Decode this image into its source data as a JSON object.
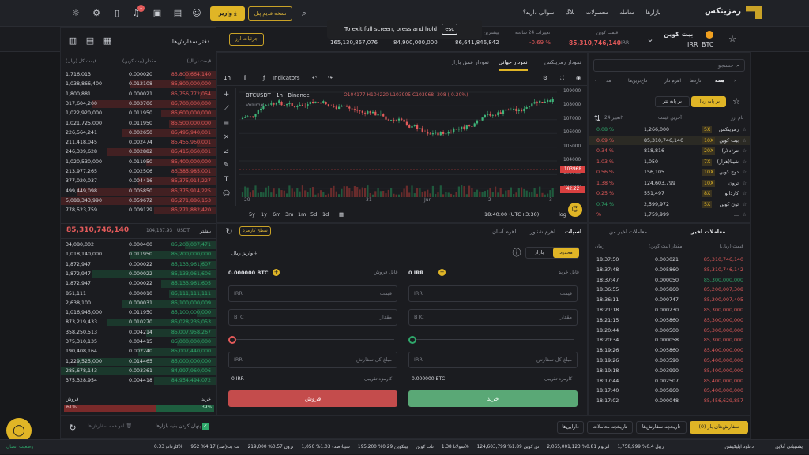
{
  "header": {
    "logo": "رمزینکس",
    "nav": [
      "بازارها",
      "معامله",
      "محصولات",
      "بلاگ",
      "سوالی دارید؟"
    ],
    "old_version": "نسخه قدیم پنل",
    "deposit": "واریز",
    "notif_count": "1"
  },
  "fullscreen_toast": {
    "text": "To exit full screen, press and hold",
    "key": "esc"
  },
  "ticker": {
    "name": "بیت کوین",
    "symbol": "BTC",
    "quote": "IRR",
    "price_label": "قیمت کوین",
    "price": "85,310,746,140",
    "price_unit": "IRR",
    "change_label": "تغییرات 24 ساعته",
    "change": "-0.69 %",
    "high_label": "بیشترین",
    "high": "86,641,846,842",
    "low": "84,900,000,000",
    "volume": "165,130,867,076",
    "details_btn": "جزئیات ارز"
  },
  "orderbook": {
    "title": "دفتر سفارش‌ها",
    "cols": [
      "قیمت (ریال)",
      "مقدار (بیت کوین)",
      "قیمت کل (ریال)"
    ],
    "asks": [
      [
        "85,800,664,140",
        "0.000020",
        "1,716,013"
      ],
      [
        "85,800,000,000",
        "0.012108",
        "1,038,866,400"
      ],
      [
        "85,756,772,054",
        "0.000021",
        "1,800,881"
      ],
      [
        "85,700,000,000",
        "0.003706",
        "317,604,200"
      ],
      [
        "85,600,000,000",
        "0.011950",
        "1,022,920,000"
      ],
      [
        "85,500,000,000",
        "0.011950",
        "1,021,725,000"
      ],
      [
        "85,495,940,001",
        "0.002650",
        "226,564,241"
      ],
      [
        "85,455,960,001",
        "0.002474",
        "211,418,045"
      ],
      [
        "85,415,060,001",
        "0.002882",
        "246,339,628"
      ],
      [
        "85,400,000,000",
        "0.011950",
        "1,020,530,000"
      ],
      [
        "85,385,985,001",
        "0.002506",
        "213,977,265"
      ],
      [
        "85,375,914,227",
        "0.004416",
        "377,020,037"
      ],
      [
        "85,375,914,225",
        "0.005850",
        "499,449,098"
      ],
      [
        "85,271,886,153",
        "0.059672",
        "5,088,343,990"
      ],
      [
        "85,271,882,420",
        "0.009129",
        "778,523,759"
      ]
    ],
    "last_price": "85,310,746,140",
    "last_label": "بیشتر",
    "last_usdt": "104,187.93",
    "last_unit": "USDT",
    "bids": [
      [
        "85,200,007,471",
        "0.000400",
        "34,080,002"
      ],
      [
        "85,200,000,000",
        "0.011950",
        "1,018,140,000"
      ],
      [
        "85,133,961,607",
        "0.000022",
        "1,872,947"
      ],
      [
        "85,133,961,606",
        "0.000022",
        "1,872,947"
      ],
      [
        "85,133,961,605",
        "0.000022",
        "1,872,947"
      ],
      [
        "85,111,111,111",
        "0.000010",
        "851,111"
      ],
      [
        "85,100,000,009",
        "0.000031",
        "2,638,100"
      ],
      [
        "85,100,000,000",
        "0.011950",
        "1,016,945,000"
      ],
      [
        "85,028,235,053",
        "0.010270",
        "873,219,433"
      ],
      [
        "85,007,958,267",
        "0.004214",
        "358,250,513"
      ],
      [
        "85,000,000,000",
        "0.004415",
        "375,310,135"
      ],
      [
        "85,007,440,000",
        "0.002240",
        "190,408,164"
      ],
      [
        "85,000,000,000",
        "0.014465",
        "1,229,525,000"
      ],
      [
        "84,997,960,006",
        "0.003361",
        "285,678,143"
      ],
      [
        "84,954,494,072",
        "0.004418",
        "375,328,954"
      ]
    ],
    "ratio_sell_label": "فروش",
    "ratio_buy_label": "خرید",
    "ratio_sell": "61%",
    "ratio_buy": "39%",
    "ratio_sell_frac": 0.61
  },
  "chart": {
    "tabs": [
      "نمودار رمزینکس",
      "نمودار جهانی",
      "نمودار عمق بازار"
    ],
    "interval": "1h",
    "indicators": "Indicators",
    "symbol_line": "BTCUSDT · 1h · Binance",
    "ohlc": "O104177 H104220 L103905 C103968 -208 (-0.20%)",
    "volume_label": "Volume",
    "volume_val": "42.22",
    "price_axis": [
      "109000",
      "108000",
      "107000",
      "106000",
      "105000",
      "104000",
      "103000",
      "102000"
    ],
    "last_tag": "103968",
    "x_axis": [
      "29",
      "31",
      "Jun",
      "2",
      "3"
    ],
    "ranges": [
      "5y",
      "1y",
      "6m",
      "3m",
      "1m",
      "5d",
      "1d"
    ],
    "time": "18:40:00 (UTC+3:30)",
    "log": "log",
    "auto": "auto"
  },
  "trade": {
    "tabs": [
      "اسپات",
      "اهرم شناور",
      "اهرم آسان"
    ],
    "fee_btn": "سطح کارمزد",
    "type_limit": "محدود",
    "type_market": "بازار",
    "deposit": "واریز ریال",
    "buy": {
      "avail_label": "قابل خرید",
      "avail": "0 IRR",
      "price_ph": "قیمت",
      "price_unit": "IRR",
      "amount_ph": "مقدار",
      "amount_unit": "BTC",
      "total_ph": "مبلغ کل سفارش",
      "total_unit": "IRR",
      "fee_label": "کارمزد تقریبی",
      "fee": "0.000000 BTC",
      "btn": "خرید"
    },
    "sell": {
      "avail_label": "قابل فروش",
      "avail": "0.000000 BTC",
      "price_ph": "قیمت",
      "price_unit": "IRR",
      "amount_ph": "مقدار",
      "amount_unit": "BTC",
      "total_ph": "مبلغ کل سفارش",
      "total_unit": "IRR",
      "fee_label": "کارمزد تقریبی",
      "fee": "0 IRR",
      "btn": "فروش"
    }
  },
  "market_list": {
    "search_ph": "جستجو",
    "tabs": [
      "همه",
      "تازه‌ها",
      "اهرم دار",
      "داغ‌ترین‌ها",
      "مد"
    ],
    "base_irr": "بر پایه ریال",
    "base_usdt": "بر پایه تتر",
    "cols": [
      "نام ارز",
      "آخرین قیمت",
      "تغییر 24h"
    ],
    "items": [
      [
        "رمزینکس",
        "5X",
        "1,266,000",
        "0.08",
        "g"
      ],
      [
        "بیت کوین",
        "10X",
        "85,310,746,140",
        "0.69",
        "r"
      ],
      [
        "تتر(دلار)",
        "20X",
        "818,816",
        "0.34",
        "r"
      ],
      [
        "شیبا(هزار)",
        "7X",
        "1,050",
        "1.03",
        "r"
      ],
      [
        "دوج کوین",
        "10X",
        "156,105",
        "0.56",
        "r"
      ],
      [
        "ترون",
        "10X",
        "124,603,799",
        "1.38",
        "r"
      ],
      [
        "کاردانو",
        "8X",
        "551,497",
        "0.25",
        "r"
      ],
      [
        "تون کوین",
        "5X",
        "2,599,972",
        "0.74",
        "g"
      ],
      [
        "...",
        "",
        "1,759,999",
        "",
        "r"
      ]
    ]
  },
  "trades": {
    "tabs": [
      "معاملات اخیر",
      "معاملات اخیر من"
    ],
    "cols": [
      "قیمت (ریال)",
      "مقدار (بیت کوین)",
      "زمان"
    ],
    "rows": [
      [
        "85,310,746,140",
        "0.003021",
        "18:37:50",
        "r"
      ],
      [
        "85,310,746,142",
        "0.005860",
        "18:37:48",
        "r"
      ],
      [
        "85,300,000,000",
        "0.000050",
        "18:37:47",
        "g"
      ],
      [
        "85,200,007,308",
        "0.005860",
        "18:36:55",
        "r"
      ],
      [
        "85,200,007,405",
        "0.000747",
        "18:36:11",
        "r"
      ],
      [
        "85,300,000,000",
        "0.000230",
        "18:21:18",
        "r"
      ],
      [
        "85,300,000,000",
        "0.005860",
        "18:21:15",
        "r"
      ],
      [
        "85,300,000,000",
        "0.000500",
        "18:20:44",
        "r"
      ],
      [
        "85,300,000,000",
        "0.000058",
        "18:20:34",
        "r"
      ],
      [
        "85,400,000,000",
        "0.005860",
        "18:19:26",
        "r"
      ],
      [
        "85,400,000,000",
        "0.003590",
        "18:19:26",
        "r"
      ],
      [
        "85,400,000,000",
        "0.003990",
        "18:19:18",
        "r"
      ],
      [
        "85,400,000,000",
        "0.002507",
        "18:17:44",
        "r"
      ],
      [
        "85,400,000,000",
        "0.005860",
        "18:17:40",
        "r"
      ],
      [
        "85,456,629,857",
        "0.000048",
        "18:17:02",
        "r"
      ]
    ]
  },
  "orders": {
    "tabs": [
      "سفارش‌های باز (0)",
      "تاریخچه سفارش‌ها",
      "تاریخچه معاملات",
      "دارایی‌ها"
    ],
    "hide_pairs": "پنهان کردن بقیه بازارها",
    "cancel_all": "لغو همه سفارش‌ها"
  },
  "bottom": {
    "support": "پشتیبانی آنلاین",
    "download": "دانلود اپلیکیشن",
    "status": "وضعیت اتصال",
    "items": [
      "ریپل 0.4% 1,758,999",
      "اتریوم 0.81% 2,065,001,123",
      "تن کوین 1.89% 124,603,799",
      "سولانا 1.38%",
      "نات کوین",
      "بیتکوین 0.29% 195,200",
      "شیبا(صد) 1.03% 1,050",
      "ترون 0.57% 219,000",
      "بت بت(صد) 4.17% 952",
      "کاردانو 0.33%"
    ]
  }
}
